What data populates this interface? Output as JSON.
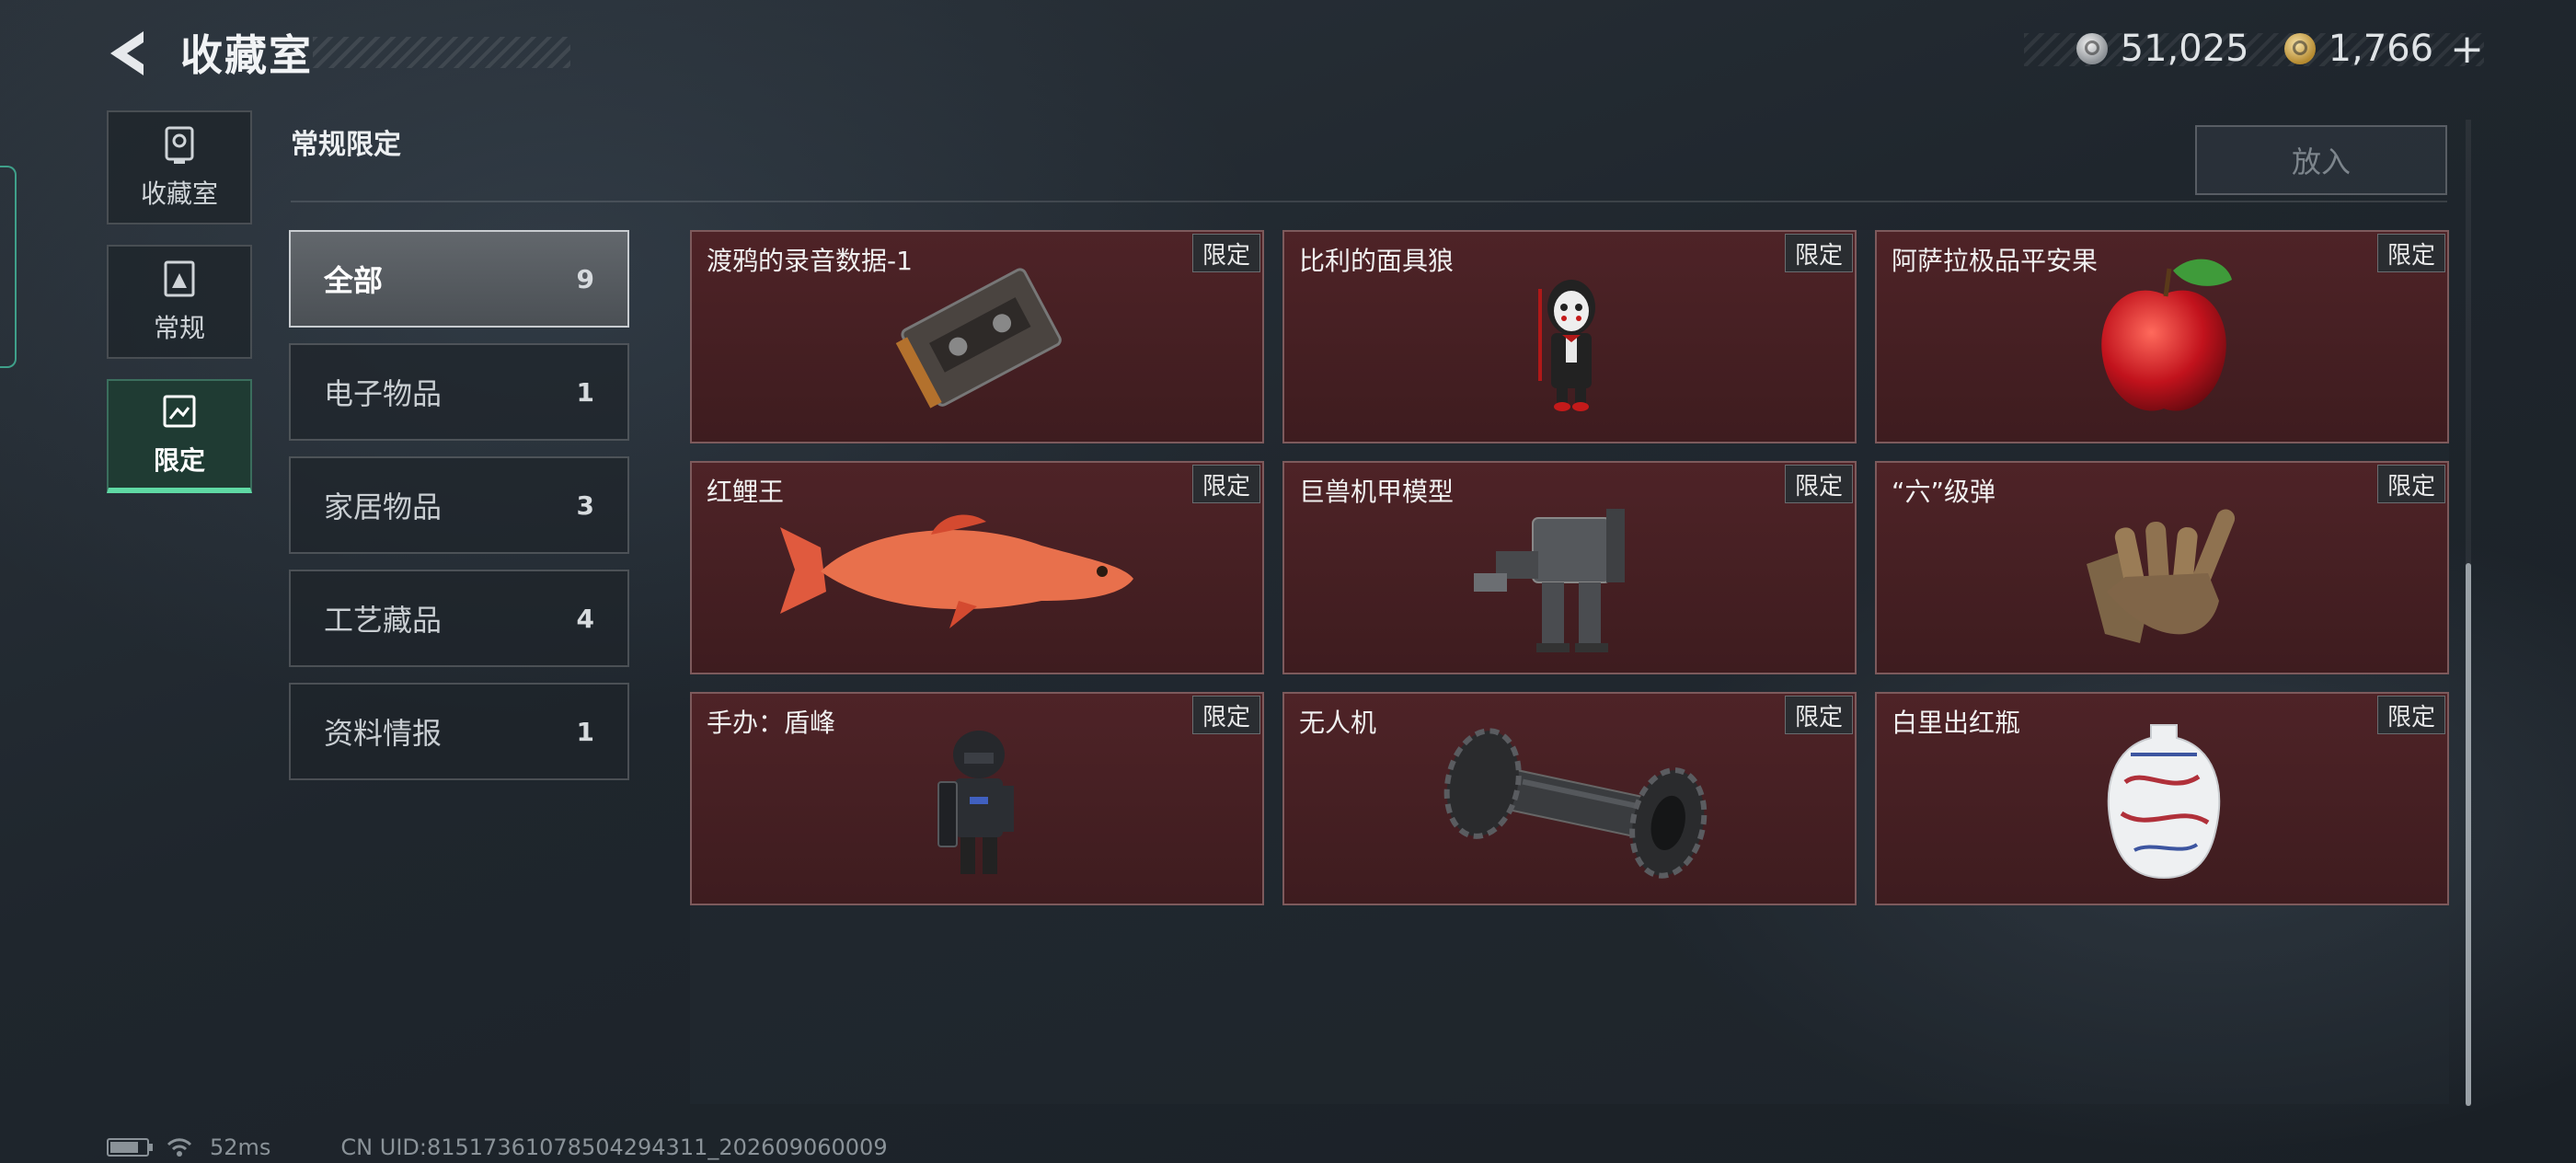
{
  "header": {
    "title": "收藏室"
  },
  "currency": {
    "silver": "51,025",
    "gold": "1,766",
    "add": "+"
  },
  "rail": [
    {
      "label": "收藏室",
      "icon": "trophy-icon",
      "active": false
    },
    {
      "label": "常规",
      "icon": "document-icon",
      "active": false
    },
    {
      "label": "限定",
      "icon": "image-icon",
      "active": true
    }
  ],
  "section": {
    "title": "常规限定",
    "put_button": "放入"
  },
  "filters": [
    {
      "label": "全部",
      "count": "9",
      "active": true
    },
    {
      "label": "电子物品",
      "count": "1"
    },
    {
      "label": "家居物品",
      "count": "3"
    },
    {
      "label": "工艺藏品",
      "count": "4"
    },
    {
      "label": "资料情报",
      "count": "1"
    }
  ],
  "items": [
    {
      "name": "渡鸦的录音数据-1",
      "tag": "限定",
      "icon": "cassette-tape-icon"
    },
    {
      "name": "比利的面具狼",
      "tag": "限定",
      "icon": "puppet-figure-icon"
    },
    {
      "name": "阿萨拉极品平安果",
      "tag": "限定",
      "icon": "apple-icon"
    },
    {
      "name": "红鲤王",
      "tag": "限定",
      "icon": "carp-fish-icon"
    },
    {
      "name": "巨兽机甲模型",
      "tag": "限定",
      "icon": "mech-model-icon"
    },
    {
      "name": "“六”级弹",
      "tag": "限定",
      "icon": "hand-sculpture-icon"
    },
    {
      "name": "手办：盾峰",
      "tag": "限定",
      "icon": "soldier-figure-icon"
    },
    {
      "name": "无人机",
      "tag": "限定",
      "icon": "drone-roller-icon"
    },
    {
      "name": "白里出红瓶",
      "tag": "限定",
      "icon": "porcelain-vase-icon"
    }
  ],
  "status": {
    "ping": "52ms",
    "uid": "CN UID:81517361078504294311_202609060009"
  },
  "colors": {
    "accent": "#5fd9a4",
    "card_bg": "#4e2327",
    "card_border": "#7d5a5c"
  }
}
